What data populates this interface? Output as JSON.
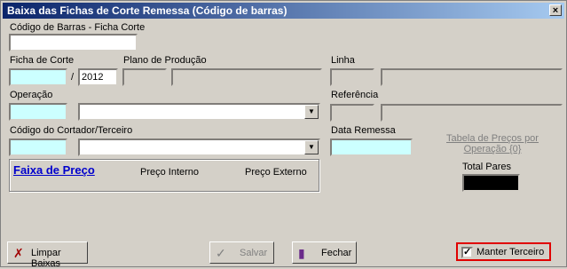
{
  "window": {
    "title": "Baixa das Fichas de Corte Remessa (Código de barras)",
    "close_label": "×"
  },
  "codigo_barras": {
    "label": "Código de Barras - Ficha Corte",
    "value": ""
  },
  "ficha_corte": {
    "label": "Ficha de Corte",
    "value": "",
    "separator": "/",
    "year": "2012"
  },
  "plano_producao": {
    "label": "Plano de Produção"
  },
  "linha": {
    "label": "Linha"
  },
  "operacao": {
    "label": "Operação"
  },
  "referencia": {
    "label": "Referência"
  },
  "cortador": {
    "label": "Código do Cortador/Terceiro"
  },
  "data_remessa": {
    "label": "Data Remessa"
  },
  "tabela_precos": {
    "label": "Tabela de Preços por Operação {0}"
  },
  "total_pares": {
    "label": "Total Pares",
    "value": ""
  },
  "faixa_preco": {
    "title": "Faixa de Preço",
    "col1": "Preço Interno",
    "col2": "Preço Externo"
  },
  "buttons": {
    "limpar": "Limpar Baixas",
    "salvar": "Salvar",
    "fechar": "Fechar"
  },
  "manter_terceiro": {
    "label": "Manter Terceiro",
    "checked": true
  },
  "colors": {
    "highlight_border": "#e00000",
    "input_cyan": "#ccffff",
    "title_start": "#0a246a"
  }
}
